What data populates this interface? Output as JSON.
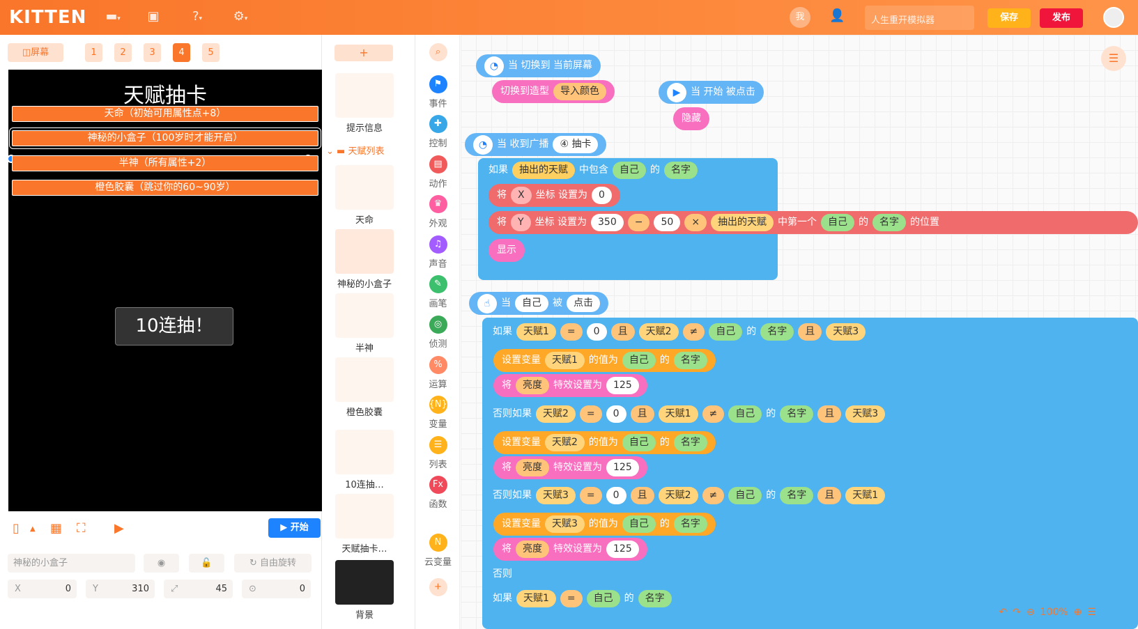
{
  "topbar": {
    "logo": "KITTEN",
    "me": "我",
    "project_name": "人生重开模拟器",
    "save": "保存",
    "publish": "发布"
  },
  "stage": {
    "screen_btn": "◫屏幕",
    "screens": [
      "1",
      "2",
      "3",
      "4",
      "5"
    ],
    "active_screen": "4",
    "title": "天赋抽卡",
    "talents": [
      "天命（初始可用属性点+8）",
      "神秘的小盒子（100岁时才能开启）",
      "半神（所有属性+2）",
      "橙色胶囊（跳过你的60~90岁）"
    ],
    "draw_button": "10连抽！",
    "start": "开始"
  },
  "props": {
    "name": "神秘的小盒子",
    "rotation": "自由旋转",
    "x_label": "X",
    "x": "0",
    "y_label": "Y",
    "y": "310",
    "size": "45",
    "angle": "0"
  },
  "sprites": {
    "add": "+",
    "items": [
      "提示信息",
      "天命",
      "神秘的小盒子",
      "半神",
      "橙色胶囊",
      "10连抽…",
      "天赋抽卡…",
      "背景"
    ],
    "folder": "天赋列表"
  },
  "categories": [
    {
      "label": "事件",
      "color": "#1e83ff"
    },
    {
      "label": "控制",
      "color": "#38a7e8"
    },
    {
      "label": "动作",
      "color": "#f05a5a"
    },
    {
      "label": "外观",
      "color": "#ff5fa0"
    },
    {
      "label": "声音",
      "color": "#a35cff"
    },
    {
      "label": "画笔",
      "color": "#3cc06d"
    },
    {
      "label": "侦测",
      "color": "#3aa958"
    },
    {
      "label": "运算",
      "color": "#ff8a65"
    },
    {
      "label": "变量",
      "color": "#ffb21a"
    },
    {
      "label": "列表",
      "color": "#ffb21a"
    },
    {
      "label": "函数",
      "color": "#f04a5a"
    },
    {
      "label": "云变量",
      "color": "#ffb21a"
    }
  ],
  "blocks": {
    "b1": "当 切换到 当前屏幕",
    "b1_a": "切换到造型",
    "b1_b": "导入颜色",
    "b2": "当 开始 被点击",
    "b2_a": "隐藏",
    "b3_head": "当 收到广播",
    "b3_msg": "④ 抽卡",
    "if": "如果",
    "b3_cond1": "抽出的天赋",
    "contains": "中包含",
    "self": "自己",
    "of": "的",
    "name": "名字",
    "set_to": "将",
    "x": "X",
    "y": "Y",
    "coord_set": "坐标 设置为",
    "zero": "0",
    "n350": "350",
    "minus": "−",
    "n50": "50",
    "times": "×",
    "first": "中第一个",
    "position": "的位置",
    "show": "显示",
    "b4_when": "当",
    "b4_click": "被",
    "b4_ev": "点击",
    "t1": "天赋1",
    "t2": "天赋2",
    "t3": "天赋3",
    "eq": "=",
    "neq": "≠",
    "and": "且",
    "set_var": "设置变量",
    "value_of": "的值为",
    "brightness": "亮度",
    "effect": "特效设置为",
    "n125": "125",
    "elseif": "否则如果",
    "else": "否则"
  },
  "zoom": "100%"
}
